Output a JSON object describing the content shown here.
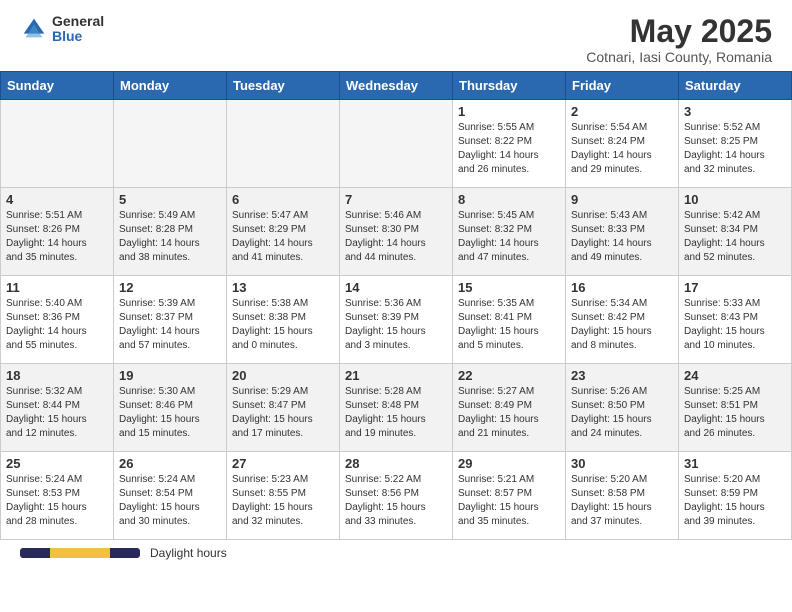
{
  "header": {
    "logo_general": "General",
    "logo_blue": "Blue",
    "title": "May 2025",
    "subtitle": "Cotnari, Iasi County, Romania"
  },
  "days_of_week": [
    "Sunday",
    "Monday",
    "Tuesday",
    "Wednesday",
    "Thursday",
    "Friday",
    "Saturday"
  ],
  "weeks": [
    [
      {
        "day": "",
        "info": ""
      },
      {
        "day": "",
        "info": ""
      },
      {
        "day": "",
        "info": ""
      },
      {
        "day": "",
        "info": ""
      },
      {
        "day": "1",
        "info": "Sunrise: 5:55 AM\nSunset: 8:22 PM\nDaylight: 14 hours\nand 26 minutes."
      },
      {
        "day": "2",
        "info": "Sunrise: 5:54 AM\nSunset: 8:24 PM\nDaylight: 14 hours\nand 29 minutes."
      },
      {
        "day": "3",
        "info": "Sunrise: 5:52 AM\nSunset: 8:25 PM\nDaylight: 14 hours\nand 32 minutes."
      }
    ],
    [
      {
        "day": "4",
        "info": "Sunrise: 5:51 AM\nSunset: 8:26 PM\nDaylight: 14 hours\nand 35 minutes."
      },
      {
        "day": "5",
        "info": "Sunrise: 5:49 AM\nSunset: 8:28 PM\nDaylight: 14 hours\nand 38 minutes."
      },
      {
        "day": "6",
        "info": "Sunrise: 5:47 AM\nSunset: 8:29 PM\nDaylight: 14 hours\nand 41 minutes."
      },
      {
        "day": "7",
        "info": "Sunrise: 5:46 AM\nSunset: 8:30 PM\nDaylight: 14 hours\nand 44 minutes."
      },
      {
        "day": "8",
        "info": "Sunrise: 5:45 AM\nSunset: 8:32 PM\nDaylight: 14 hours\nand 47 minutes."
      },
      {
        "day": "9",
        "info": "Sunrise: 5:43 AM\nSunset: 8:33 PM\nDaylight: 14 hours\nand 49 minutes."
      },
      {
        "day": "10",
        "info": "Sunrise: 5:42 AM\nSunset: 8:34 PM\nDaylight: 14 hours\nand 52 minutes."
      }
    ],
    [
      {
        "day": "11",
        "info": "Sunrise: 5:40 AM\nSunset: 8:36 PM\nDaylight: 14 hours\nand 55 minutes."
      },
      {
        "day": "12",
        "info": "Sunrise: 5:39 AM\nSunset: 8:37 PM\nDaylight: 14 hours\nand 57 minutes."
      },
      {
        "day": "13",
        "info": "Sunrise: 5:38 AM\nSunset: 8:38 PM\nDaylight: 15 hours\nand 0 minutes."
      },
      {
        "day": "14",
        "info": "Sunrise: 5:36 AM\nSunset: 8:39 PM\nDaylight: 15 hours\nand 3 minutes."
      },
      {
        "day": "15",
        "info": "Sunrise: 5:35 AM\nSunset: 8:41 PM\nDaylight: 15 hours\nand 5 minutes."
      },
      {
        "day": "16",
        "info": "Sunrise: 5:34 AM\nSunset: 8:42 PM\nDaylight: 15 hours\nand 8 minutes."
      },
      {
        "day": "17",
        "info": "Sunrise: 5:33 AM\nSunset: 8:43 PM\nDaylight: 15 hours\nand 10 minutes."
      }
    ],
    [
      {
        "day": "18",
        "info": "Sunrise: 5:32 AM\nSunset: 8:44 PM\nDaylight: 15 hours\nand 12 minutes."
      },
      {
        "day": "19",
        "info": "Sunrise: 5:30 AM\nSunset: 8:46 PM\nDaylight: 15 hours\nand 15 minutes."
      },
      {
        "day": "20",
        "info": "Sunrise: 5:29 AM\nSunset: 8:47 PM\nDaylight: 15 hours\nand 17 minutes."
      },
      {
        "day": "21",
        "info": "Sunrise: 5:28 AM\nSunset: 8:48 PM\nDaylight: 15 hours\nand 19 minutes."
      },
      {
        "day": "22",
        "info": "Sunrise: 5:27 AM\nSunset: 8:49 PM\nDaylight: 15 hours\nand 21 minutes."
      },
      {
        "day": "23",
        "info": "Sunrise: 5:26 AM\nSunset: 8:50 PM\nDaylight: 15 hours\nand 24 minutes."
      },
      {
        "day": "24",
        "info": "Sunrise: 5:25 AM\nSunset: 8:51 PM\nDaylight: 15 hours\nand 26 minutes."
      }
    ],
    [
      {
        "day": "25",
        "info": "Sunrise: 5:24 AM\nSunset: 8:53 PM\nDaylight: 15 hours\nand 28 minutes."
      },
      {
        "day": "26",
        "info": "Sunrise: 5:24 AM\nSunset: 8:54 PM\nDaylight: 15 hours\nand 30 minutes."
      },
      {
        "day": "27",
        "info": "Sunrise: 5:23 AM\nSunset: 8:55 PM\nDaylight: 15 hours\nand 32 minutes."
      },
      {
        "day": "28",
        "info": "Sunrise: 5:22 AM\nSunset: 8:56 PM\nDaylight: 15 hours\nand 33 minutes."
      },
      {
        "day": "29",
        "info": "Sunrise: 5:21 AM\nSunset: 8:57 PM\nDaylight: 15 hours\nand 35 minutes."
      },
      {
        "day": "30",
        "info": "Sunrise: 5:20 AM\nSunset: 8:58 PM\nDaylight: 15 hours\nand 37 minutes."
      },
      {
        "day": "31",
        "info": "Sunrise: 5:20 AM\nSunset: 8:59 PM\nDaylight: 15 hours\nand 39 minutes."
      }
    ]
  ],
  "footer": {
    "daylight_label": "Daylight hours"
  }
}
